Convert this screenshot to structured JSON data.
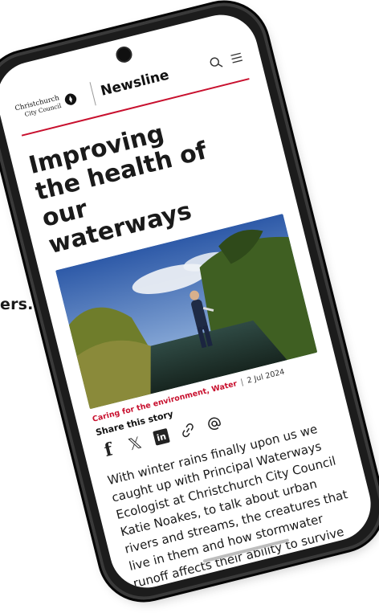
{
  "background": {
    "text_fragment": "ers."
  },
  "header": {
    "logo_line1": "Christchurch",
    "logo_line2": "City Council",
    "brand": "Newsline",
    "icons": [
      "search-icon",
      "menu-icon"
    ],
    "accent_color": "#c8102e"
  },
  "article": {
    "title": "Improving the health of our waterways",
    "tags": "Caring for the environment, Water",
    "separator": "|",
    "date": "2 Jul 2024",
    "share_label": "Share this story",
    "share_icons": [
      "facebook-icon",
      "x-icon",
      "linkedin-icon",
      "link-icon",
      "email-icon"
    ],
    "summary": "With winter rains finally upon us we caught up with Principal Waterways Ecologist at Christchurch City Council Katie Noakes, to talk about urban rivers and streams, the creatures that live in them and how stormwater runoff affects their ability to survive"
  }
}
